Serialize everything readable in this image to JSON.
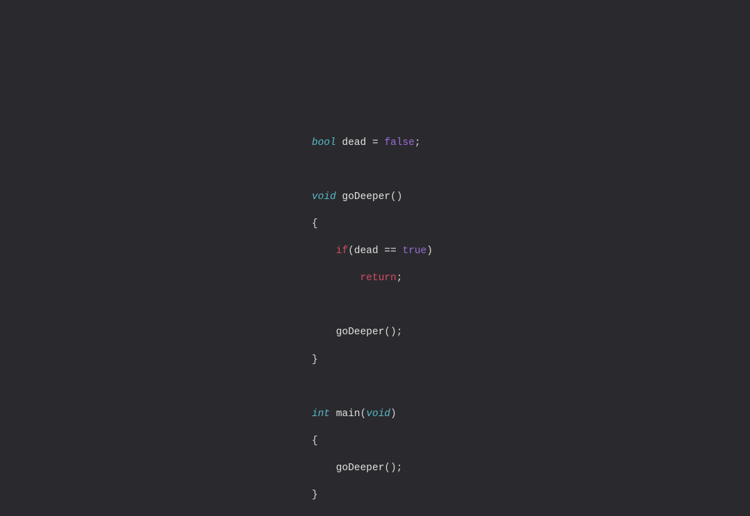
{
  "code": {
    "colors": {
      "bg": "#2a2a2e",
      "type": "#58b8c8",
      "ident": "#e0e0e0",
      "keyword": "#d84a63",
      "boolean": "#9a6dd7",
      "punct": "#d8d8d8"
    },
    "tokens": {
      "t_bool": "bool",
      "i_dead": "dead",
      "eq": "=",
      "b_false": "false",
      "semi": ";",
      "t_void": "void",
      "i_goDeeper": "goDeeper",
      "lparen": "(",
      "rparen": ")",
      "lbrace": "{",
      "rbrace": "}",
      "k_if": "if",
      "eqeq": "==",
      "b_true": "true",
      "k_return": "return",
      "t_int": "int",
      "i_main": "main",
      "t_void2": "void"
    }
  }
}
